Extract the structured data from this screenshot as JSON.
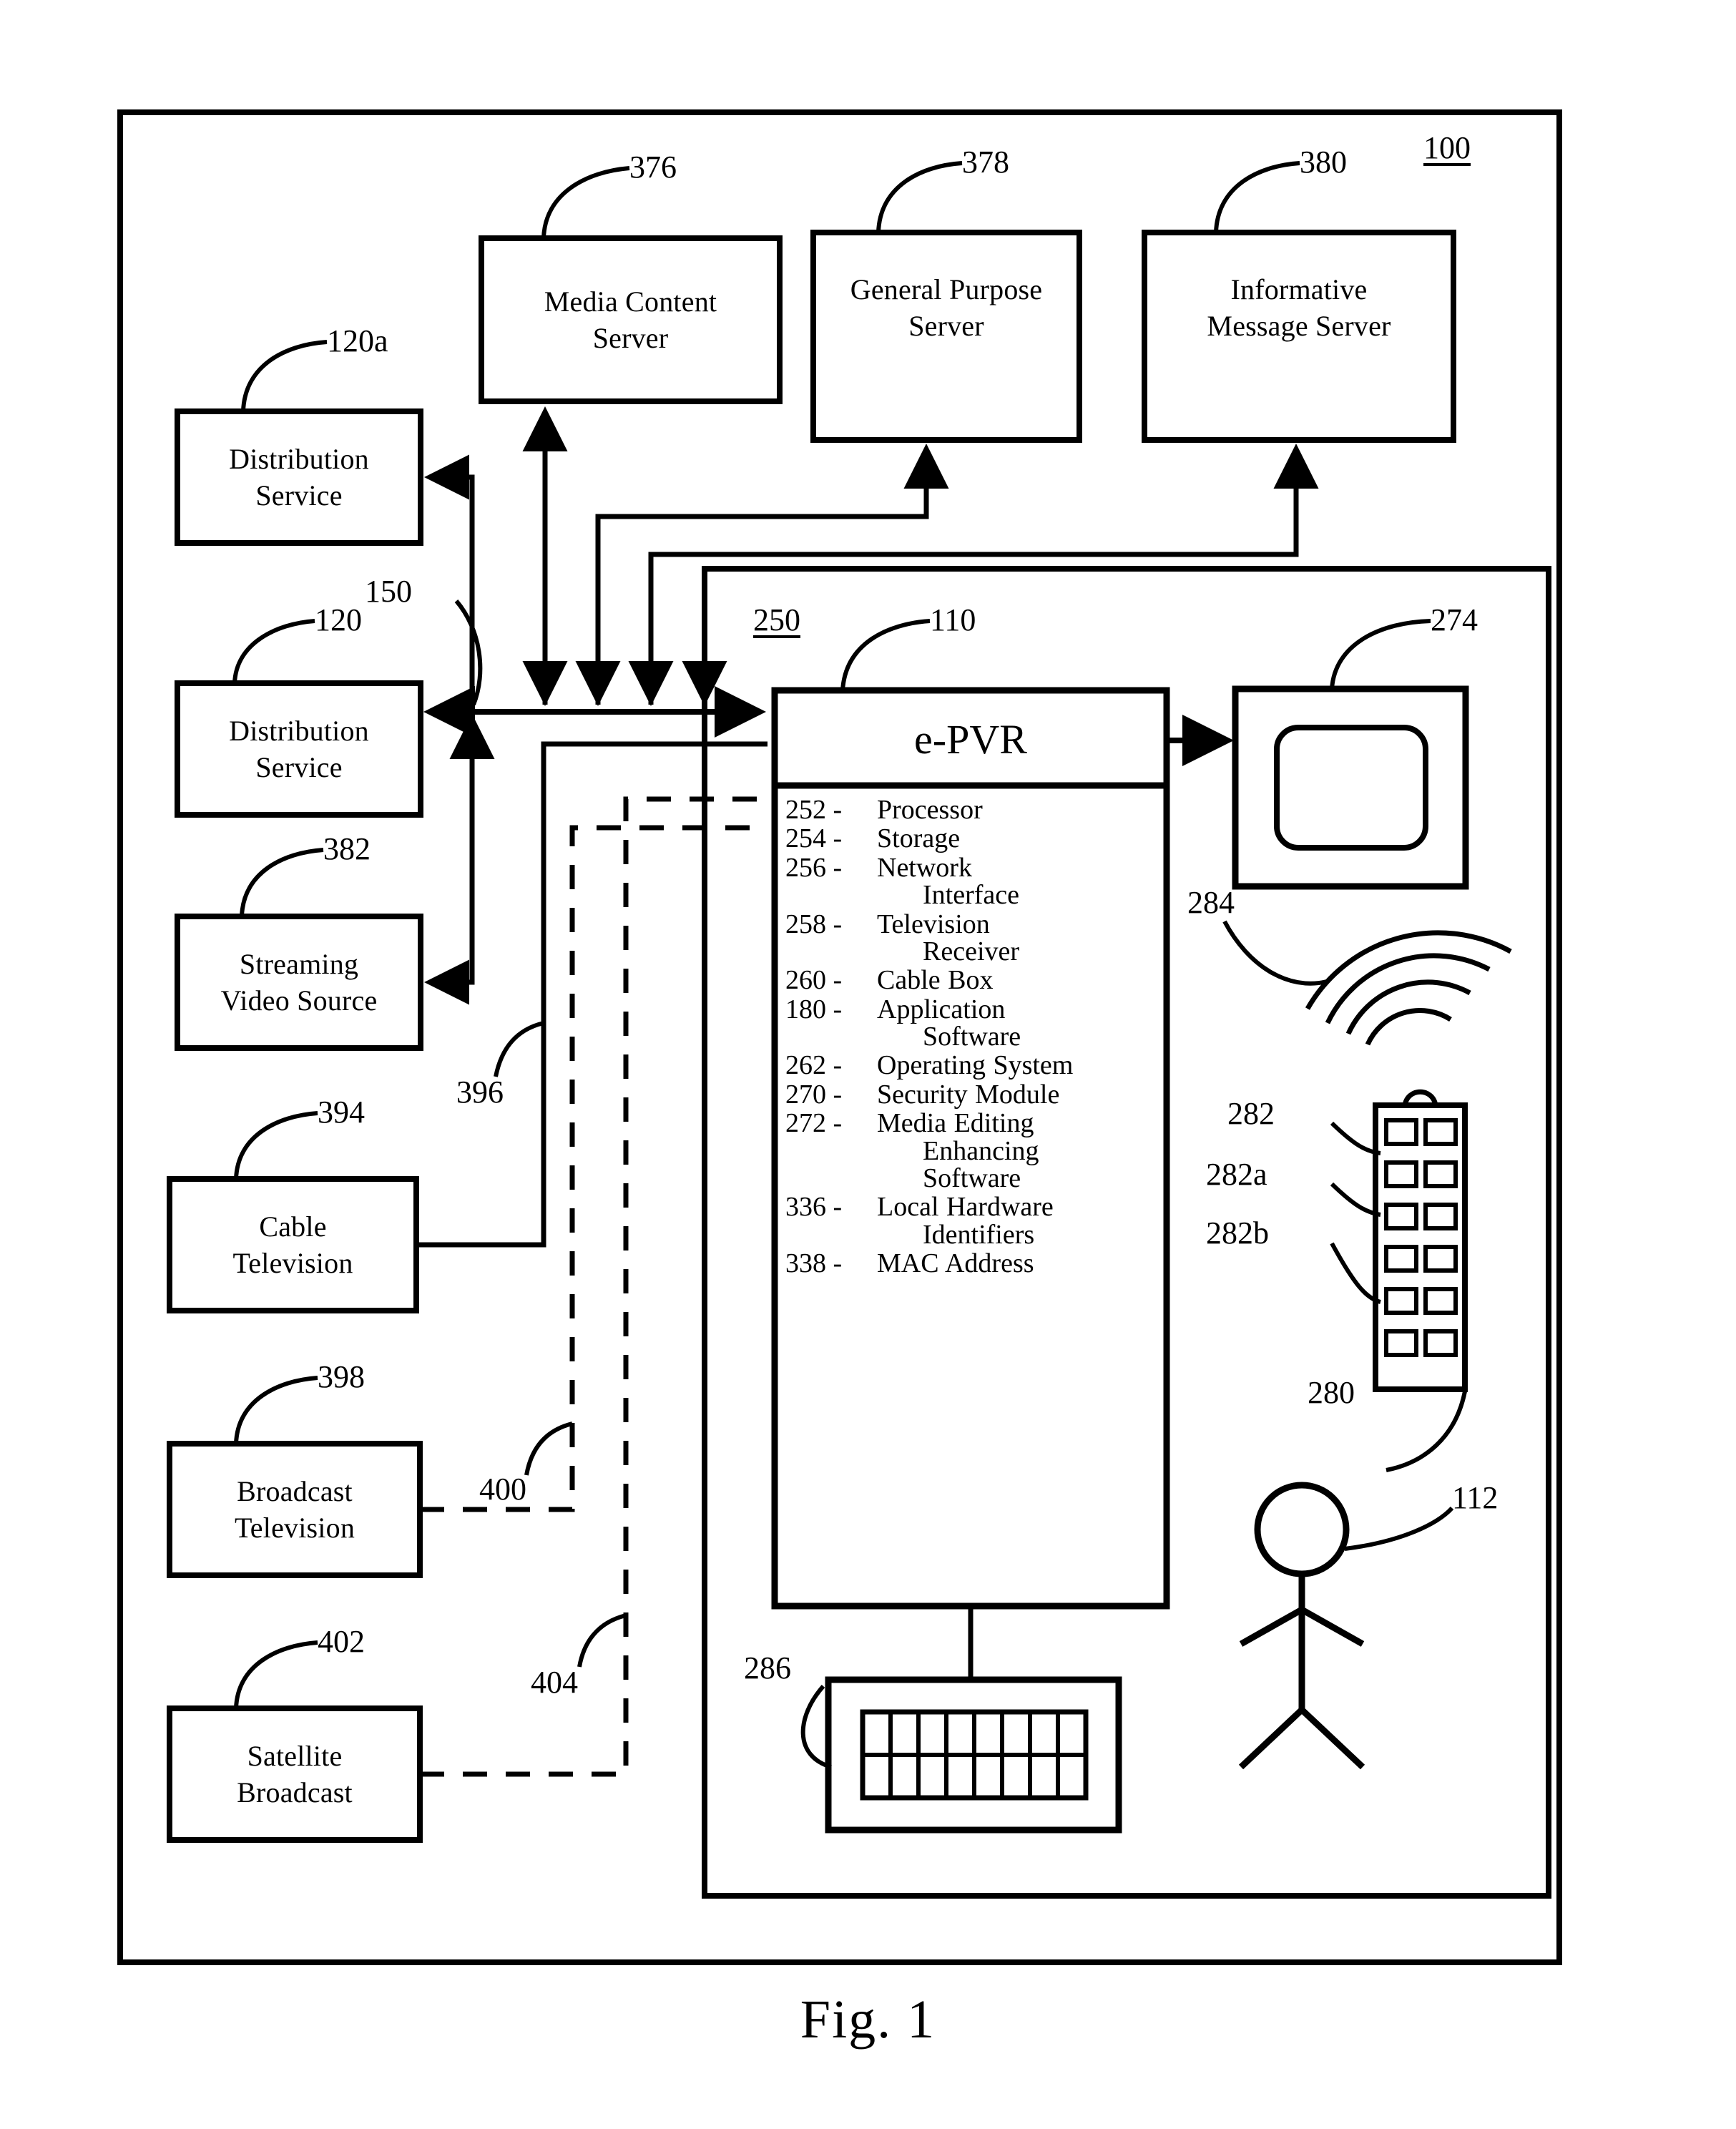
{
  "figure": {
    "caption": "Fig. 1",
    "system_ref": "100",
    "home_env_ref": "250"
  },
  "servers": [
    {
      "ref": "376",
      "lines": [
        "Media Content",
        "Server"
      ]
    },
    {
      "ref": "378",
      "lines": [
        "General Purpose",
        "Server"
      ]
    },
    {
      "ref": "380",
      "lines": [
        "Informative",
        "Message Server"
      ]
    }
  ],
  "sources": [
    {
      "ref": "120a",
      "lines": [
        "Distribution",
        "Service"
      ]
    },
    {
      "ref": "120",
      "lines": [
        "Distribution",
        "Service"
      ]
    },
    {
      "ref": "382",
      "lines": [
        "Streaming",
        "Video Source"
      ]
    },
    {
      "ref": "394",
      "lines": [
        "Cable",
        "Television"
      ]
    },
    {
      "ref": "398",
      "lines": [
        "Broadcast",
        "Television"
      ]
    },
    {
      "ref": "402",
      "lines": [
        "Satellite",
        "Broadcast"
      ]
    }
  ],
  "epvr": {
    "title": "e-PVR",
    "ref": "110",
    "components": [
      {
        "num": "252 -",
        "name": "Processor"
      },
      {
        "num": "254 -",
        "name": "Storage"
      },
      {
        "num": "256 -",
        "name": "Network",
        "name2": "Interface"
      },
      {
        "num": "258 -",
        "name": "Television",
        "name2": "Receiver"
      },
      {
        "num": "260 -",
        "name": "Cable Box"
      },
      {
        "num": "180 -",
        "name": "Application",
        "name2": "Software"
      },
      {
        "num": "262 -",
        "name": "Operating System"
      },
      {
        "num": "270 -",
        "name": "Security Module"
      },
      {
        "num": "272 -",
        "name": "Media Editing",
        "name2": "Enhancing",
        "name3": "Software"
      },
      {
        "num": "336 -",
        "name": "Local Hardware",
        "name2": "Identifiers"
      },
      {
        "num": "338 -",
        "name": "MAC Address"
      }
    ]
  },
  "devices": {
    "display_ref": "274",
    "signal_ref": "284",
    "remote_ref": "280",
    "remote_buttons_ref": "282",
    "remote_button_a_ref": "282a",
    "remote_button_b_ref": "282b",
    "keyboard_ref": "286",
    "user_ref": "112"
  },
  "connections": {
    "network_ref": "150",
    "cable_link_ref": "396",
    "broadcast_link_ref": "400",
    "satellite_link_ref": "404"
  },
  "colors": {
    "ink": "#000000",
    "paper": "#ffffff"
  }
}
